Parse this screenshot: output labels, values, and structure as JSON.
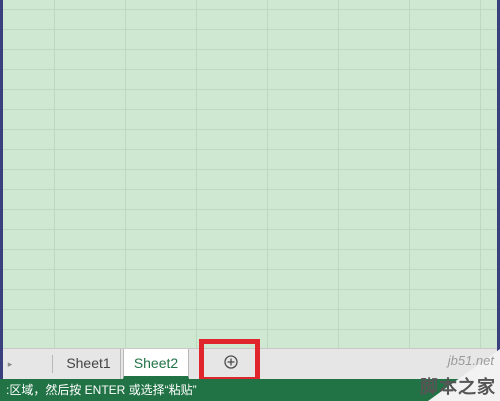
{
  "tabs": {
    "scroll_arrow": "▸",
    "sheets": [
      {
        "label": "Sheet1",
        "active": false
      },
      {
        "label": "Sheet2",
        "active": true
      }
    ],
    "add_button": {
      "icon": "plus-circle-icon",
      "highlight_color": "#e0262c"
    }
  },
  "status": {
    "message": ":区域，然后按 ENTER 或选择“粘贴”"
  },
  "watermark": {
    "url": "jb51.net",
    "site_name": "脚本之家"
  },
  "colors": {
    "grid_bg": "#cfe8d1",
    "status_bar": "#217346",
    "accent_red": "#e0262c",
    "active_tab_text": "#217346"
  }
}
